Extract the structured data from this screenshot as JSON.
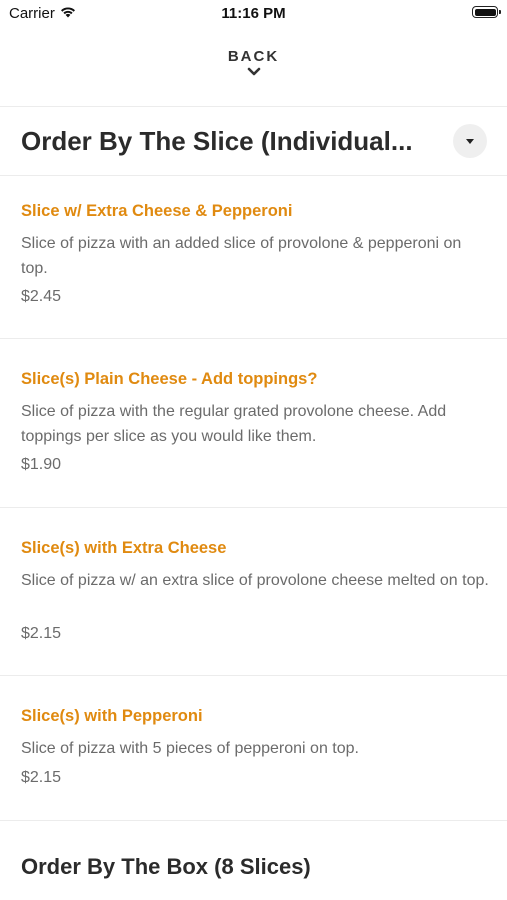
{
  "status_bar": {
    "carrier": "Carrier",
    "time": "11:16 PM"
  },
  "nav": {
    "back_label": "BACK"
  },
  "section": {
    "title": "Order By The Slice (Individual..."
  },
  "items": [
    {
      "name": "Slice w/ Extra Cheese & Pepperoni",
      "description": "Slice of pizza with an added slice of provolone & pepperoni on top.",
      "price": "$2.45"
    },
    {
      "name": "Slice(s) Plain Cheese - Add toppings?",
      "description": "Slice of pizza with the regular grated provolone cheese. Add toppings per slice as you would like them.",
      "price": "$1.90"
    },
    {
      "name": "Slice(s) with Extra Cheese",
      "description": "Slice of pizza w/ an extra slice of provolone cheese melted on top.",
      "price": "$2.15"
    },
    {
      "name": "Slice(s) with Pepperoni",
      "description": "Slice of pizza with 5 pieces of pepperoni on top.",
      "price": "$2.15"
    }
  ],
  "next_section": {
    "title": "Order By The Box (8 Slices)"
  },
  "colors": {
    "accent": "#e08a10",
    "text_dark": "#2b2b2b",
    "text_muted": "#6b6b6b"
  }
}
